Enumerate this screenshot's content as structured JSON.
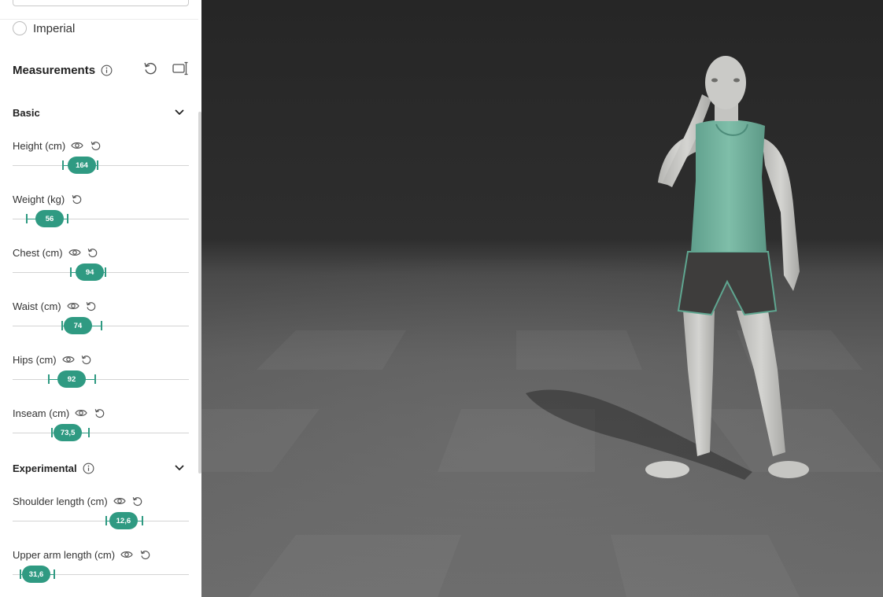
{
  "units": {
    "imperial_label": "Imperial"
  },
  "measurements": {
    "title": "Measurements",
    "sections": {
      "basic": "Basic",
      "experimental": "Experimental"
    },
    "fields": [
      {
        "key": "height",
        "label": "Height (cm)",
        "value": "164",
        "has_eye": true,
        "range_start": 0.286,
        "range_end": 0.483,
        "value_fraction": 0.393
      },
      {
        "key": "weight",
        "label": "Weight (kg)",
        "value": "56",
        "has_eye": false,
        "range_start": 0.08,
        "range_end": 0.313,
        "value_fraction": 0.21
      },
      {
        "key": "chest",
        "label": "Chest (cm)",
        "value": "94",
        "has_eye": true,
        "range_start": 0.33,
        "range_end": 0.527,
        "value_fraction": 0.438
      },
      {
        "key": "waist",
        "label": "Waist (cm)",
        "value": "74",
        "has_eye": true,
        "range_start": 0.281,
        "range_end": 0.505,
        "value_fraction": 0.37
      },
      {
        "key": "hips",
        "label": "Hips (cm)",
        "value": "92",
        "has_eye": true,
        "range_start": 0.205,
        "range_end": 0.469,
        "value_fraction": 0.335
      },
      {
        "key": "inseam",
        "label": "Inseam (cm)",
        "value": "73,5",
        "has_eye": true,
        "range_start": 0.223,
        "range_end": 0.433,
        "value_fraction": 0.313
      },
      {
        "key": "shoulder_length",
        "label": "Shoulder length (cm)",
        "value": "12,6",
        "has_eye": true,
        "range_start": 0.531,
        "range_end": 0.737,
        "value_fraction": 0.629
      },
      {
        "key": "upper_arm_length",
        "label": "Upper arm length (cm)",
        "value": "31,6",
        "has_eye": true,
        "range_start": 0.045,
        "range_end": 0.237,
        "value_fraction": 0.134
      }
    ]
  },
  "icons": {
    "info": "info-icon",
    "reset_all": "reset-icon",
    "ruler": "ruler-icon",
    "visibility": "eye-icon",
    "reset_field": "reset-icon",
    "collapse": "chevron-down-icon"
  },
  "colors": {
    "accent": "#2f9a82",
    "viewport_background": "#2a2a2a",
    "floor": "#6a6a6a",
    "shirt": "#78b9a4",
    "shorts": "#3e3d3c",
    "skin": "#c9c9c6"
  }
}
